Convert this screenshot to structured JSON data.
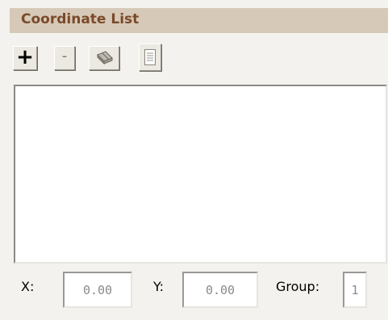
{
  "panel": {
    "title": "Coordinate List"
  },
  "toolbar": {
    "add_label": "+",
    "remove_label": "-",
    "erase_icon": "eraser-icon",
    "document_icon": "document-icon"
  },
  "coordinate_list": {
    "items": []
  },
  "fields": {
    "x_label": "X:",
    "x_value": "0.00",
    "y_label": "Y:",
    "y_value": "0.00",
    "group_label": "Group:",
    "group_value": "1"
  },
  "colors": {
    "title_background": "#d6c9b7",
    "title_text": "#7a4a2a",
    "panel_background": "#f4f2ee"
  }
}
